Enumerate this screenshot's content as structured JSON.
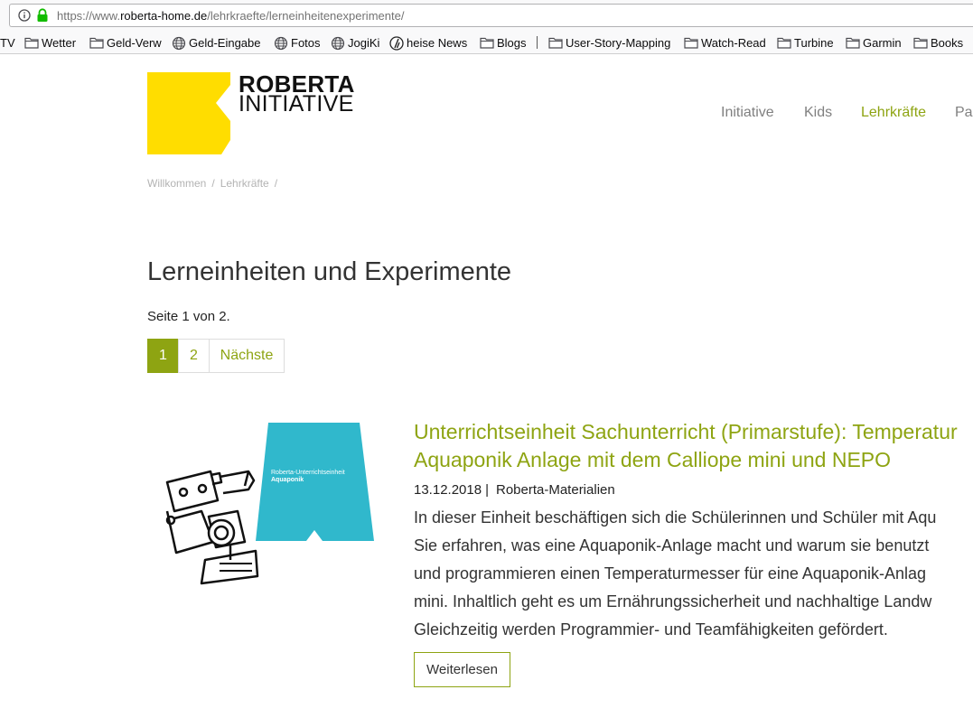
{
  "browser": {
    "url_prefix": "https://www.",
    "url_domain": "roberta-home.de",
    "url_path": "/lehrkraefte/lerneinheitenexperimente/",
    "bookmarks": [
      {
        "label": "TV",
        "icon": "none"
      },
      {
        "label": "Wetter",
        "icon": "folder-icon"
      },
      {
        "label": "Geld-Verw",
        "icon": "folder-icon"
      },
      {
        "label": "Geld-Eingabe",
        "icon": "globe-icon"
      },
      {
        "label": "Fotos",
        "icon": "globe-icon"
      },
      {
        "label": "JogiKi",
        "icon": "globe-icon"
      },
      {
        "label": "heise News",
        "icon": "heise-icon"
      },
      {
        "label": "Blogs",
        "icon": "folder-icon"
      },
      {
        "label": "User-Story-Mapping",
        "icon": "folder-icon"
      },
      {
        "label": "Watch-Read",
        "icon": "folder-icon"
      },
      {
        "label": "Turbine",
        "icon": "folder-icon"
      },
      {
        "label": "Garmin",
        "icon": "folder-icon"
      },
      {
        "label": "Books",
        "icon": "folder-icon"
      }
    ]
  },
  "site": {
    "logo_line1": "ROBERTA",
    "logo_line2": "INITIATIVE",
    "logo_color": "#ffdd00",
    "accent_color": "#8ea412",
    "nav": [
      {
        "label": "Initiative",
        "active": false
      },
      {
        "label": "Kids",
        "active": false
      },
      {
        "label": "Lehrkräfte",
        "active": true
      },
      {
        "label": "Pa",
        "active": false
      }
    ],
    "breadcrumb": [
      "Willkommen",
      "Lehrkräfte"
    ],
    "breadcrumb_sep": "/"
  },
  "main": {
    "title": "Lerneinheiten und Experimente",
    "page_info": "Seite 1 von 2.",
    "pagination": [
      {
        "label": "1",
        "current": true
      },
      {
        "label": "2",
        "current": false
      },
      {
        "label": "Nächste",
        "current": false
      }
    ],
    "article": {
      "thumb_line1": "Roberta-Unterrichtseinheit",
      "thumb_line2": "Aquaponik",
      "thumb_color": "#30b8cc",
      "title_line1": "Unterrichtseinheit Sachunterricht (Primarstufe): Temperatur",
      "title_line2": "Aquaponik Anlage mit dem Calliope mini und NEPO",
      "date": "13.12.2018",
      "meta_sep": "|",
      "category": "Roberta-Materialien",
      "excerpt": [
        "In dieser Einheit beschäftigen sich die Schülerinnen und Schüler mit Aqu",
        "Sie erfahren, was eine Aquaponik-Anlage macht und warum sie benutzt",
        "und programmieren einen Temperaturmesser für eine Aquaponik-Anlag",
        "mini. Inhaltlich geht es um Ernährungssicherheit und nachhaltige Landw",
        "Gleichzeitig werden Programmier- und Teamfähigkeiten gefördert."
      ],
      "readmore": "Weiterlesen"
    }
  }
}
